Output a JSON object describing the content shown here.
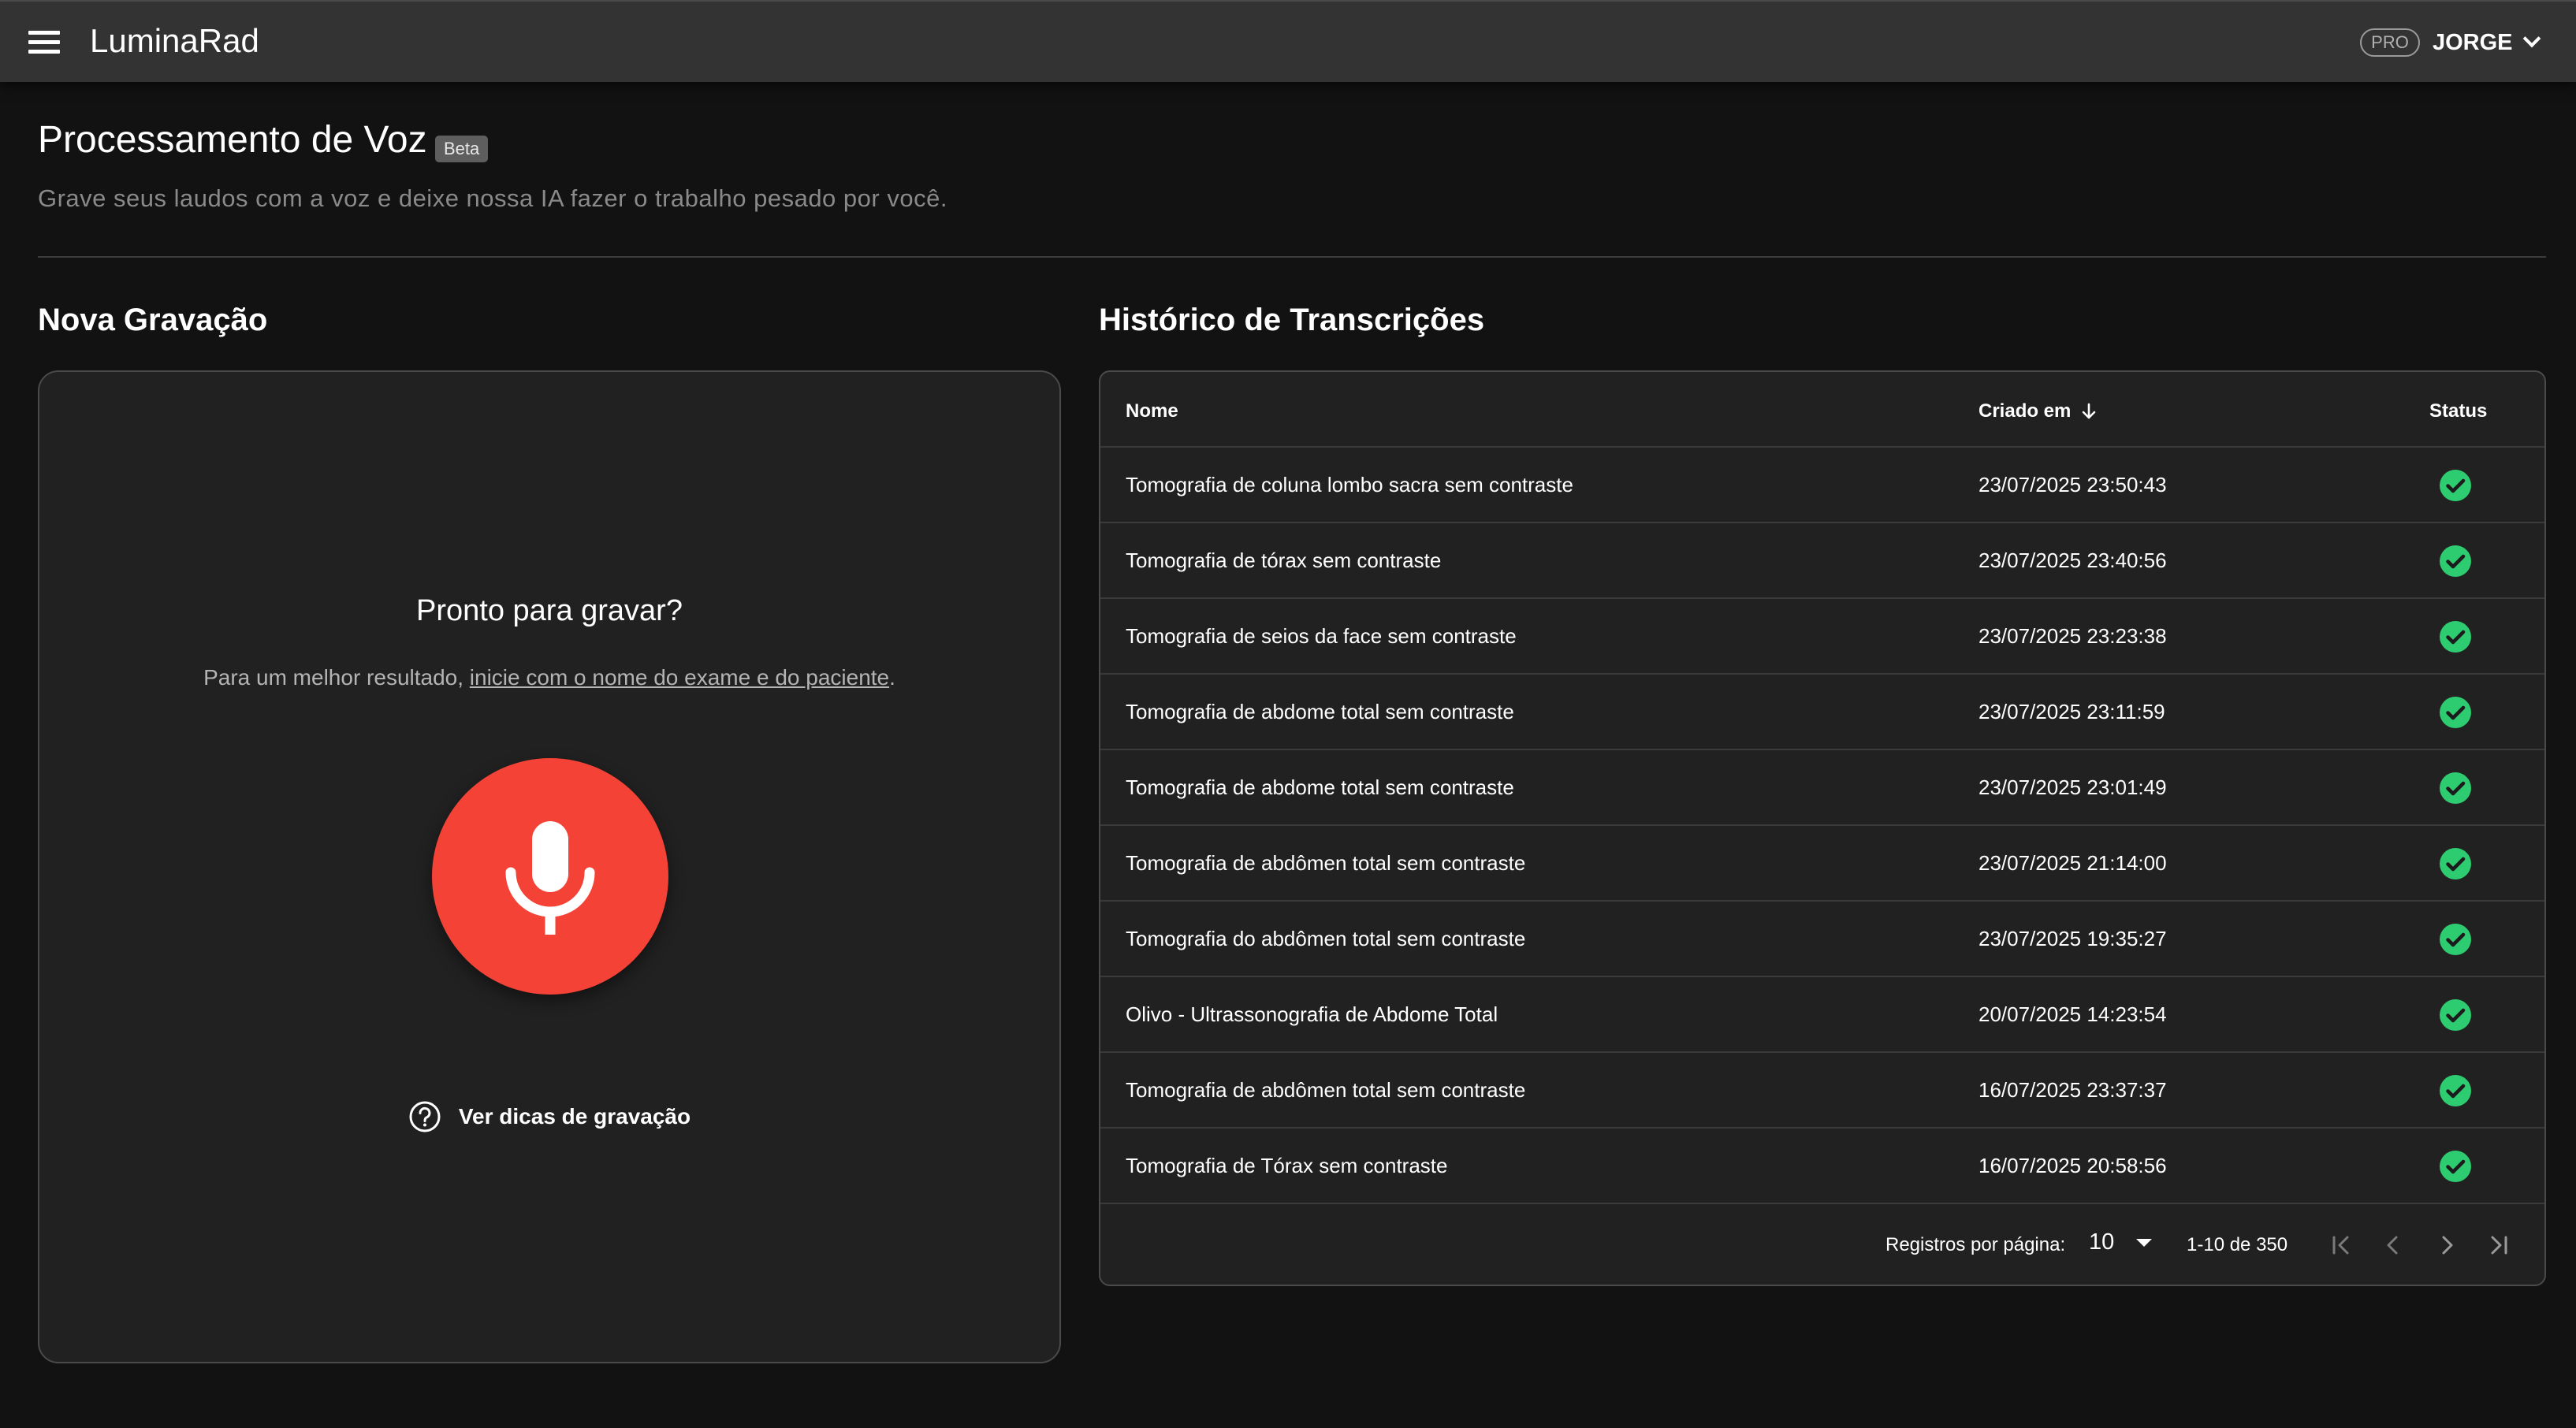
{
  "app": {
    "title": "LuminaRad"
  },
  "user": {
    "badge": "PRO",
    "name": "JORGE"
  },
  "page": {
    "title": "Processamento de Voz",
    "badge": "Beta",
    "subtitle": "Grave seus laudos com a voz e deixe nossa IA fazer o trabalho pesado por você."
  },
  "recording": {
    "section_title": "Nova Gravação",
    "ready_text": "Pronto para gravar?",
    "hint_prefix": "Para um melhor resultado, ",
    "hint_link": "inicie com o nome do exame e do paciente",
    "hint_suffix": ".",
    "tips_label": "Ver dicas de gravação",
    "mic_color": "#f44336",
    "mic_icon": "microphone-icon",
    "tips_icon": "help-circle-icon"
  },
  "history": {
    "section_title": "Histórico de Transcrições",
    "columns": {
      "name": "Nome",
      "created": "Criado em",
      "status": "Status"
    },
    "sort_icon": "arrow-down-icon",
    "status_color": "#2ecc71",
    "status_icon": "check-circle-icon",
    "rows": [
      {
        "name": "Tomografia de coluna lombo sacra sem contraste",
        "created": "23/07/2025 23:50:43"
      },
      {
        "name": "Tomografia de tórax sem contraste",
        "created": "23/07/2025 23:40:56"
      },
      {
        "name": "Tomografia de seios da face sem contraste",
        "created": "23/07/2025 23:23:38"
      },
      {
        "name": "Tomografia de abdome total sem contraste",
        "created": "23/07/2025 23:11:59"
      },
      {
        "name": "Tomografia de abdome total sem contraste",
        "created": "23/07/2025 23:01:49"
      },
      {
        "name": "Tomografia de abdômen total sem contraste",
        "created": "23/07/2025 21:14:00"
      },
      {
        "name": "Tomografia do abdômen total sem contraste",
        "created": "23/07/2025 19:35:27"
      },
      {
        "name": "Olivo - Ultrassonografia de Abdome Total",
        "created": "20/07/2025 14:23:54"
      },
      {
        "name": "Tomografia de abdômen total sem contraste",
        "created": "16/07/2025 23:37:37"
      },
      {
        "name": "Tomografia de Tórax sem contraste",
        "created": "16/07/2025 20:58:56"
      }
    ],
    "pagination": {
      "per_page_label": "Registros por página:",
      "per_page_value": "10",
      "range": "1-10 de 350"
    }
  }
}
